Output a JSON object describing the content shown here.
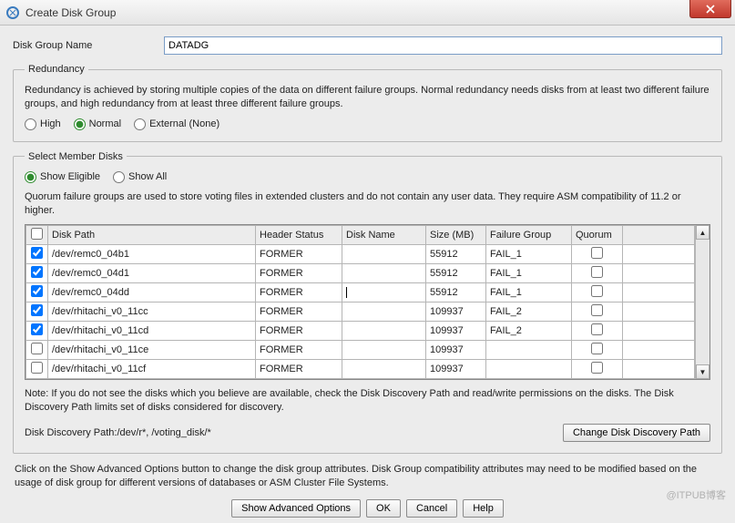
{
  "window": {
    "title": "Create Disk Group"
  },
  "diskGroupName": {
    "label": "Disk Group Name",
    "value": "DATADG"
  },
  "redundancy": {
    "legend": "Redundancy",
    "desc": "Redundancy is achieved by storing multiple copies of the data on different failure groups. Normal redundancy needs disks from at least two different failure groups, and high redundancy from at least three different failure groups.",
    "options": {
      "high": "High",
      "normal": "Normal",
      "external": "External (None)"
    }
  },
  "select": {
    "legend": "Select Member Disks",
    "showEligible": "Show Eligible",
    "showAll": "Show All",
    "quorumDesc": "Quorum failure groups are used to store voting files in extended clusters and do not contain any user data. They require ASM compatibility of 11.2 or higher.",
    "headers": {
      "path": "Disk Path",
      "hstatus": "Header Status",
      "dname": "Disk Name",
      "size": "Size (MB)",
      "fg": "Failure Group",
      "quorum": "Quorum"
    },
    "rows": [
      {
        "chk": true,
        "path": "/dev/remc0_04b1",
        "hstatus": "FORMER",
        "dname": "",
        "size": "55912",
        "fg": "FAIL_1",
        "caret": false
      },
      {
        "chk": true,
        "path": "/dev/remc0_04d1",
        "hstatus": "FORMER",
        "dname": "",
        "size": "55912",
        "fg": "FAIL_1",
        "caret": false
      },
      {
        "chk": true,
        "path": "/dev/remc0_04dd",
        "hstatus": "FORMER",
        "dname": "",
        "size": "55912",
        "fg": "FAIL_1",
        "caret": true
      },
      {
        "chk": true,
        "path": "/dev/rhitachi_v0_11cc",
        "hstatus": "FORMER",
        "dname": "",
        "size": "109937",
        "fg": "FAIL_2",
        "caret": false
      },
      {
        "chk": true,
        "path": "/dev/rhitachi_v0_11cd",
        "hstatus": "FORMER",
        "dname": "",
        "size": "109937",
        "fg": "FAIL_2",
        "caret": false
      },
      {
        "chk": false,
        "path": "/dev/rhitachi_v0_11ce",
        "hstatus": "FORMER",
        "dname": "",
        "size": "109937",
        "fg": "",
        "caret": false
      },
      {
        "chk": false,
        "path": "/dev/rhitachi_v0_11cf",
        "hstatus": "FORMER",
        "dname": "",
        "size": "109937",
        "fg": "",
        "caret": false
      }
    ],
    "note": "Note: If you do not see the disks which you believe are available, check the Disk Discovery Path and read/write permissions on the disks. The Disk Discovery Path limits set of disks considered for discovery.",
    "discoveryLabel": "Disk Discovery Path:/dev/r*, /voting_disk/*",
    "changePath": "Change Disk Discovery Path"
  },
  "footerText": "Click on the Show Advanced Options button to change the disk group attributes. Disk Group compatibility attributes may need to be modified based on the usage of disk group for different versions of databases or ASM Cluster File Systems.",
  "buttons": {
    "advanced": "Show Advanced Options",
    "ok": "OK",
    "cancel": "Cancel",
    "help": "Help"
  },
  "watermark": "@ITPUB博客"
}
